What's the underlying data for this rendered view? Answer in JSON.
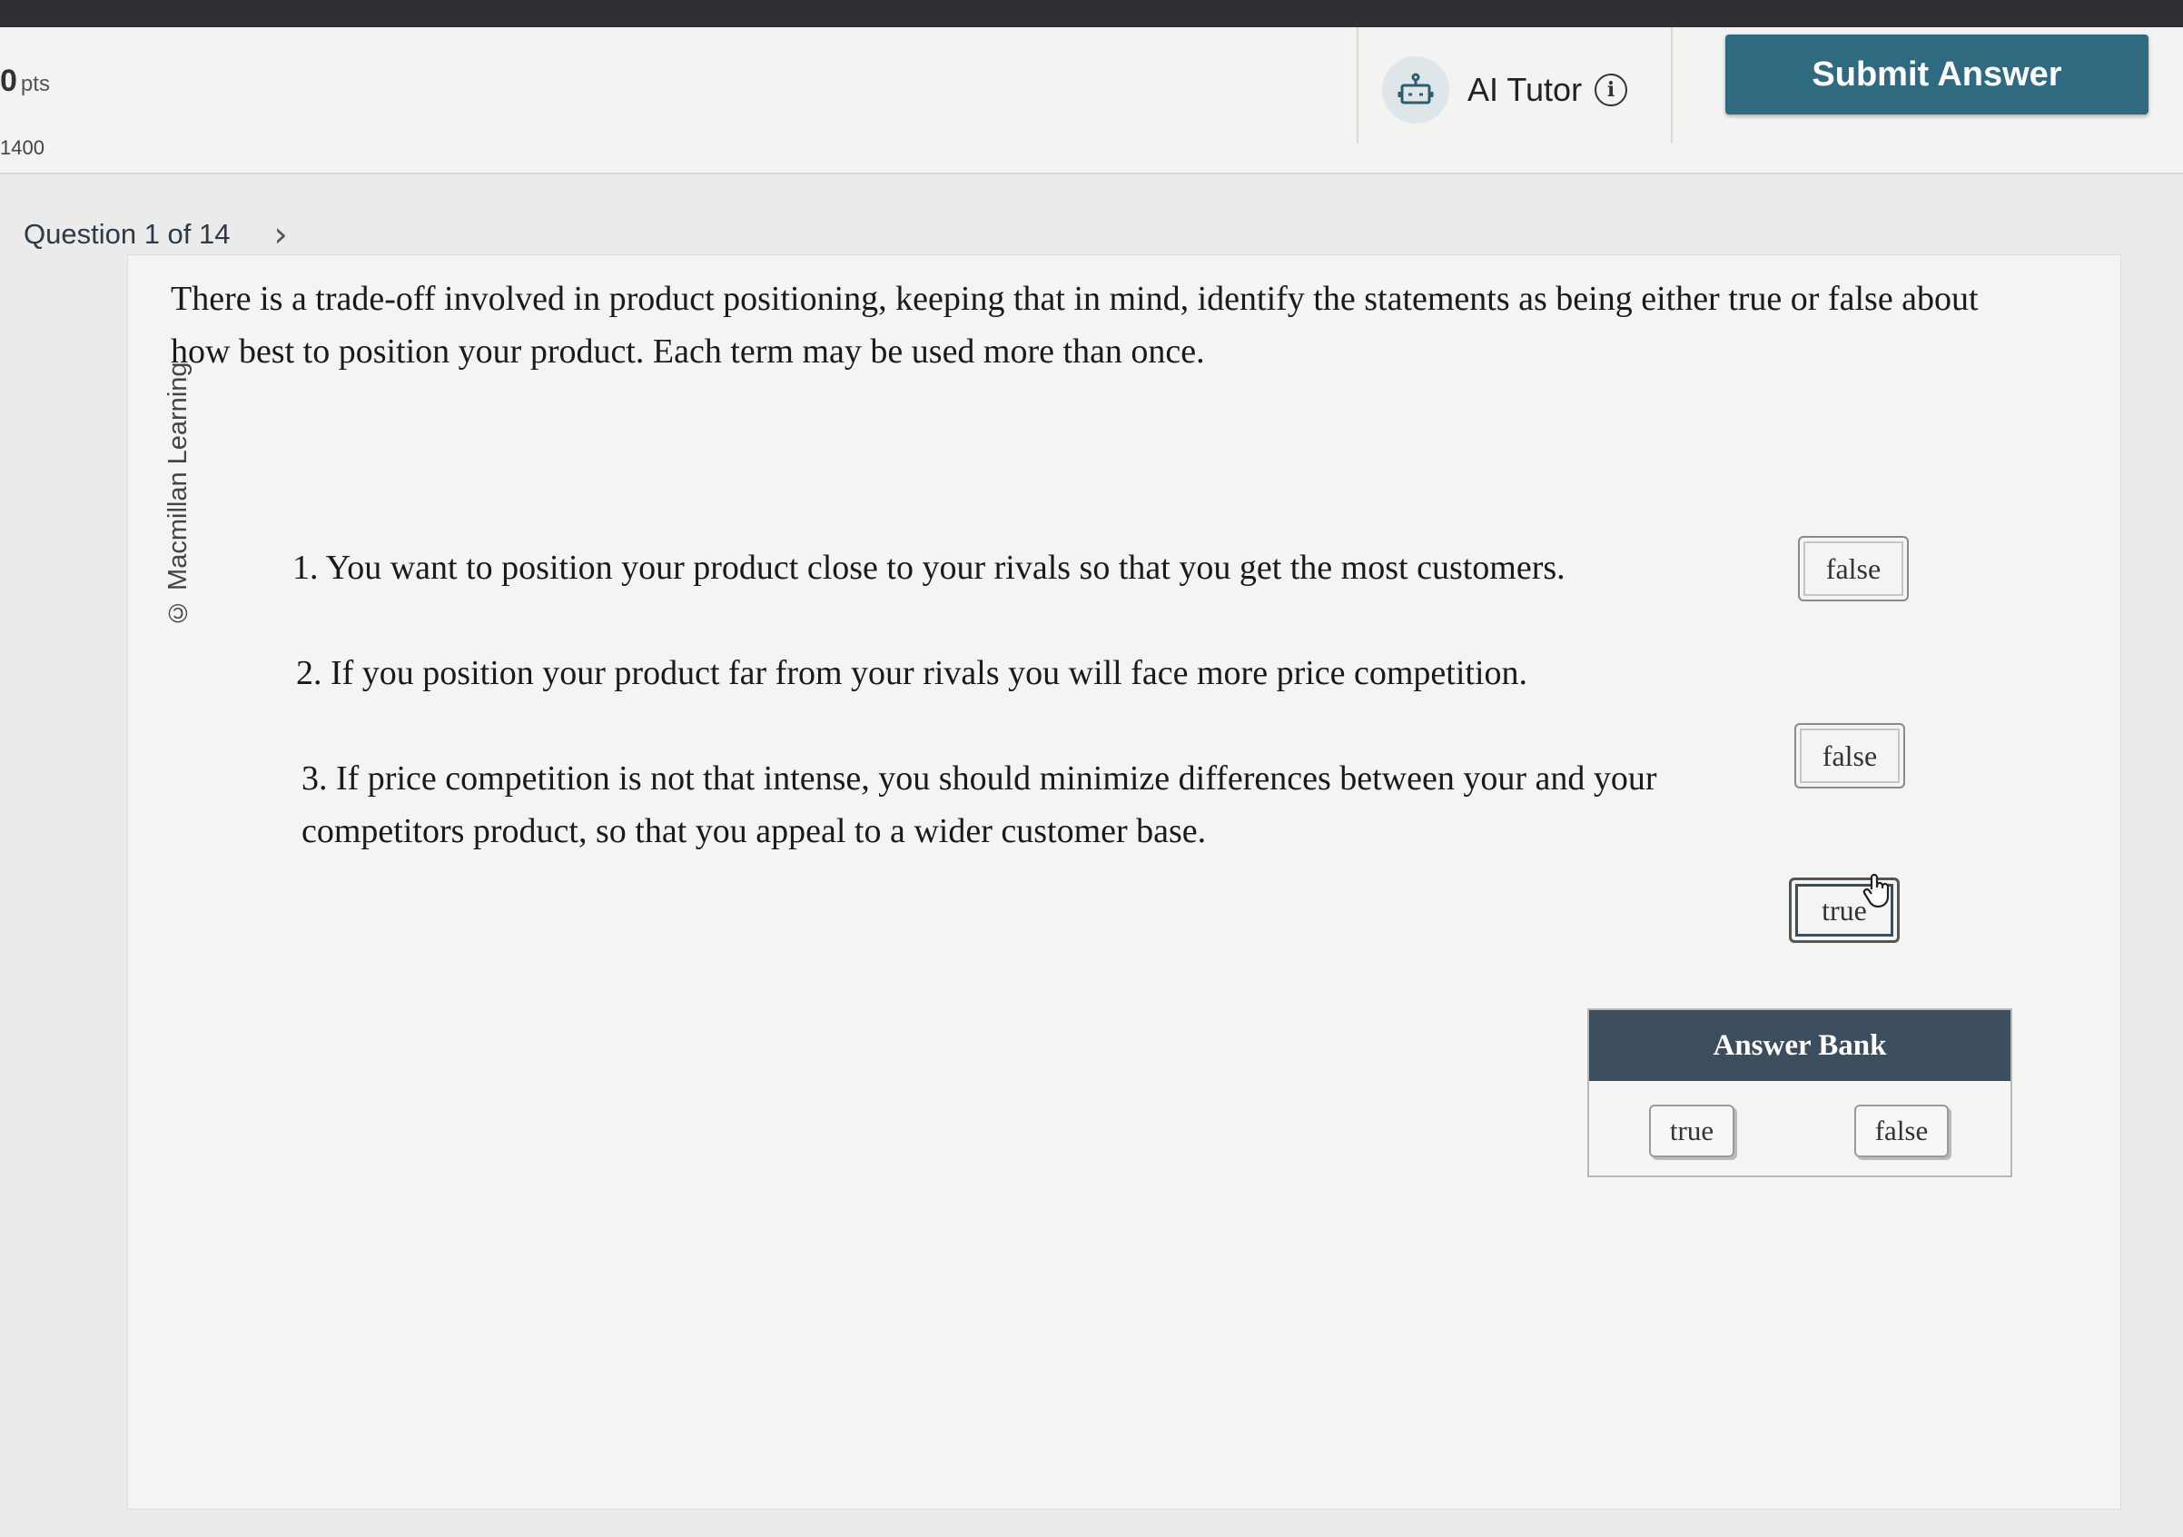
{
  "header": {
    "points_value": "0",
    "points_unit": "pts",
    "points_sub": "1400",
    "ai_tutor_label": "AI Tutor",
    "submit_label": "Submit Answer"
  },
  "question_nav": {
    "label": "Question 1 of 14"
  },
  "content": {
    "credit": "© Macmillan Learning",
    "prompt": "There is a trade-off involved in product positioning, keeping that in mind, identify the statements as being either true or false about how best to position your product. Each term may be used more than once.",
    "statements": [
      {
        "text": "1. You want to position your product close to your rivals so that you get the most customers.",
        "answer": "false"
      },
      {
        "text": "2. If you position your product far from your rivals you will face more price competition.",
        "answer": "false"
      },
      {
        "text": "3. If price competition is not that intense, you should minimize differences between your and your competitors product, so that you appeal to a wider customer base.",
        "answer": "true"
      }
    ]
  },
  "answer_bank": {
    "title": "Answer Bank",
    "items": [
      "true",
      "false"
    ]
  },
  "colors": {
    "submit_button": "#2f6b80",
    "answer_bank_header": "#3c4d5e",
    "top_strip": "#2e3035"
  },
  "icons": {
    "tutor": "robot-icon",
    "info": "info-icon",
    "next": "chevron-right-icon",
    "cursor": "hand-pointer-icon"
  }
}
